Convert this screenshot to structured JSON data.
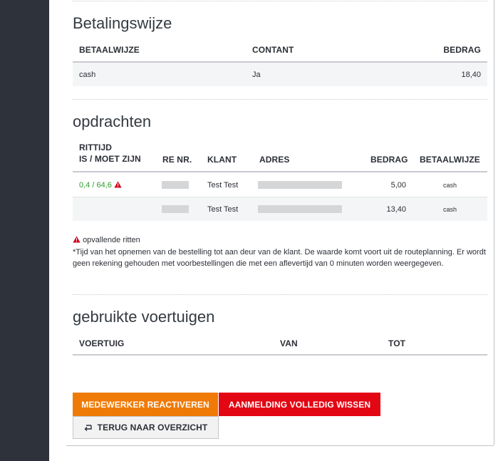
{
  "betaling": {
    "title": "Betalingswijze",
    "headers": [
      "BETAALWIJZE",
      "CONTANT",
      "BEDRAG"
    ],
    "rows": [
      {
        "betaalwijze": "cash",
        "contant": "Ja",
        "bedrag": "18,40"
      }
    ]
  },
  "opdrachten": {
    "title": "opdrachten",
    "headers": {
      "rittijd_line1": "RITTIJD",
      "rittijd_line2": "IS / MOET ZIJN",
      "re_nr": "RE NR.",
      "klant": "KLANT",
      "adres": "ADRES",
      "bedrag": "BEDRAG",
      "betaalwijze": "BETAALWIJZE"
    },
    "rows": [
      {
        "rittijd": "0,4 / 64,6",
        "klant": "Test Test",
        "bedrag": "5,00",
        "betaalwijze": "cash"
      },
      {
        "rittijd": "",
        "klant": "Test Test",
        "bedrag": "13,40",
        "betaalwijze": "cash"
      }
    ],
    "legend": "opvallende ritten",
    "footnote": "*Tijd van het opnemen van de bestelling tot aan deur van de klant. De waarde komt voort uit de routeplanning. Er wordt geen rekening gehouden met voorbestellingen die met een aflevertijd van 0 minuten worden weergegeven."
  },
  "voertuigen": {
    "title": "gebruikte voertuigen",
    "headers": [
      "VOERTUIG",
      "VAN",
      "TOT"
    ]
  },
  "buttons": {
    "reactivate": "MEDEWERKER REACTIVEREN",
    "delete": "AANMELDING VOLLEDIG WISSEN",
    "back": "TERUG NAAR OVERZICHT"
  },
  "colors": {
    "orange": "#f07a06",
    "red": "#e30613",
    "green": "#2e9e2e",
    "warning": "#d0021b",
    "sidebar": "#2e323a"
  },
  "icons": {
    "warning": "warning-triangle-icon",
    "back": "return-arrow-icon"
  }
}
